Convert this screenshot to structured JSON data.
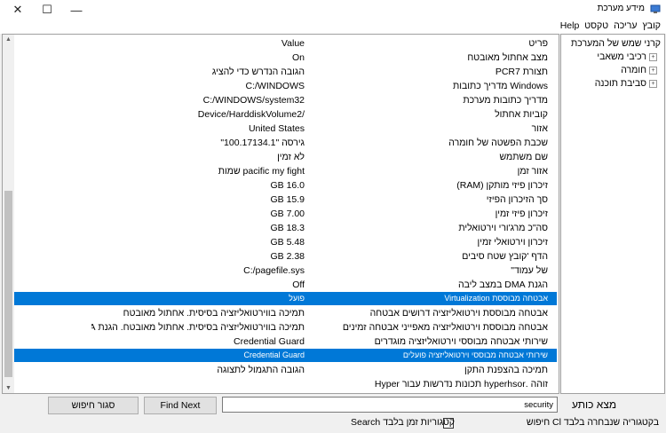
{
  "window": {
    "title": "מידע מערכת",
    "minimize_glyph": "—",
    "maximize_glyph": "☐",
    "close_glyph": "✕"
  },
  "menu": [
    "קובץ",
    "עריכה",
    "טקסט",
    "Help"
  ],
  "tree": {
    "root": "קרני שמש של המערכת",
    "children": [
      "רכיבי משאבי",
      "חומרה",
      "סביבת תוכנה"
    ]
  },
  "table": {
    "header": {
      "item": "פריט",
      "value": "Value"
    },
    "rows": [
      {
        "item": "מצב אחתול מאובטח",
        "value": "On"
      },
      {
        "item": "תצורת PCR7",
        "value": "הגובה הנדרש כדי להציג"
      },
      {
        "item": "Windows מדריך כתובות",
        "value": "C:/WINDOWS"
      },
      {
        "item": "מדריך כתובות מערכת",
        "value": "C:/WINDOWS/system32"
      },
      {
        "item": "קוביות אחתול",
        "value": "/Device/HarddiskVolume2"
      },
      {
        "item": "אזור",
        "value": "United States"
      },
      {
        "item": "שכבת הפשטה של חומרה",
        "value": "גירסה \"100.17134.1\""
      },
      {
        "item": "שם משתמש",
        "value": "לא זמין"
      },
      {
        "item": "אזור זמן",
        "value": "pacific my fight שמות"
      },
      {
        "item": "זיכרון פיזי מותקן (RAM)",
        "value": "16.0 GB"
      },
      {
        "item": "סך הזיכרון הפיזי",
        "value": "15.9 GB"
      },
      {
        "item": "זיכרון פיזי זמין",
        "value": "7.00 GB"
      },
      {
        "item": "סה\"כ מרג'ורי וירטואלית",
        "value": "18.3 GB"
      },
      {
        "item": "זיכרון וירטואלי זמין",
        "value": "5.48 GB"
      },
      {
        "item": "הדף 'קובץ שטח סיבים",
        "value": "2.38 GB"
      },
      {
        "item": "של עמוד\"",
        "value": "C:/pagefile.sys"
      },
      {
        "item": "הגנת DMA במצב ליבה",
        "value": "Off"
      },
      {
        "item": "אבטחה מבוססת Virtualization",
        "value": "פועל",
        "selected": true
      },
      {
        "item": "אבטחה מבוססת וירטואליזציה דרושים אבטחה",
        "value": "תמיכה בווירטואליזציה בסיסית. אחתול מאובטח"
      },
      {
        "item": "אבטחה מבוססת וירטואליזציה מאפייני אבטחה זמינים",
        "value": "תמיכה בווירטואליזציה בסיסית. אחתול מאובטח. הגנת DMA ..."
      },
      {
        "item": "שירותי אבטחה מבוססי וירטואליזציה מוגדרים",
        "value": "Credential Guard"
      },
      {
        "item": "שירותי אבטחה מבוססי וירטואליזציה פועלים",
        "value": "Credential Guard",
        "selected": true
      },
      {
        "item": "תמיכה בהצפנת התקן",
        "value": "הגובה התגמול לתצוגה"
      },
      {
        "item": "זוהה .hyperhsor תכונות נדרשות עבור Hyper",
        "value": ""
      }
    ]
  },
  "find": {
    "label": "מצא כותע",
    "input_value": "security",
    "find_next": "Find Next",
    "close_find": "סגור חיפוש",
    "search_category_only": "חיפוש Cl בקטגוריה שנבחרה בלבד",
    "search_category_names_only": "Search קטגוריות זמן בלבד"
  }
}
